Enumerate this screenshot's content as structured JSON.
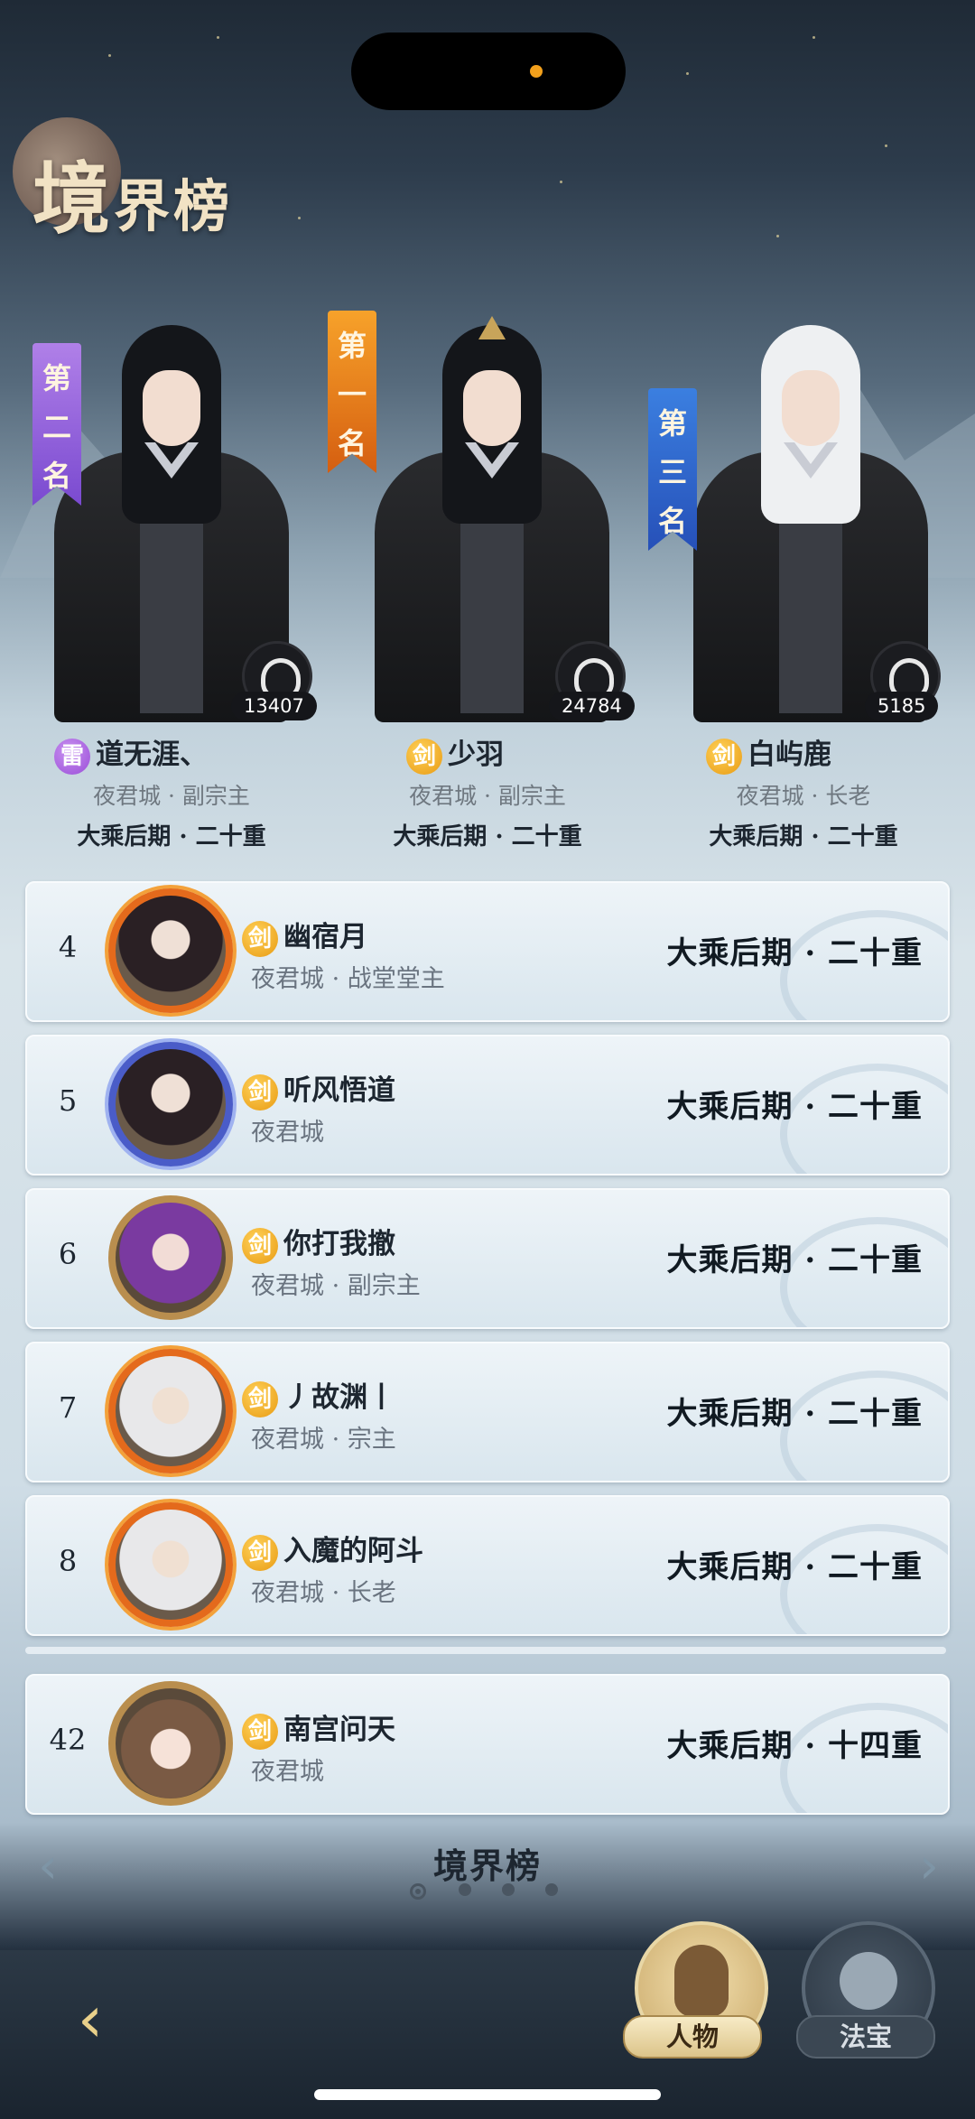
{
  "page": {
    "title_big": "境",
    "title_rest": "界榜"
  },
  "podium": [
    {
      "banner": "第二名",
      "element": "雷",
      "element_type": "thunder",
      "name": "道无涯、",
      "sect": "夜君城 · 副宗主",
      "realm": "大乘后期 · 二十重",
      "power": "13407"
    },
    {
      "banner": "第一名",
      "element": "剑",
      "element_type": "sword",
      "name": "少羽",
      "sect": "夜君城 · 副宗主",
      "realm": "大乘后期 · 二十重",
      "power": "24784"
    },
    {
      "banner": "第三名",
      "element": "剑",
      "element_type": "sword",
      "name": "白屿鹿",
      "sect": "夜君城 · 长老",
      "realm": "大乘后期 · 二十重",
      "power": "5185"
    }
  ],
  "rows": [
    {
      "rank": "4",
      "element": "剑",
      "name": "幽宿月",
      "sect": "夜君城 · 战堂堂主",
      "realm": "大乘后期 · 二十重"
    },
    {
      "rank": "5",
      "element": "剑",
      "name": "听风悟道",
      "sect": "夜君城",
      "realm": "大乘后期 · 二十重"
    },
    {
      "rank": "6",
      "element": "剑",
      "name": "你打我撤",
      "sect": "夜君城 · 副宗主",
      "realm": "大乘后期 · 二十重"
    },
    {
      "rank": "7",
      "element": "剑",
      "name": "丿故渊丨",
      "sect": "夜君城 · 宗主",
      "realm": "大乘后期 · 二十重"
    },
    {
      "rank": "8",
      "element": "剑",
      "name": "入魔的阿斗",
      "sect": "夜君城 · 长老",
      "realm": "大乘后期 · 二十重"
    }
  ],
  "self_row": {
    "rank": "42",
    "element": "剑",
    "name": "南宫问天",
    "sect": "夜君城",
    "realm": "大乘后期 · 十四重"
  },
  "footer": {
    "title": "境界榜",
    "page_index": 1,
    "page_count": 4,
    "prev_icon": "‹",
    "next_icon": "›"
  },
  "bottom_nav": {
    "back_icon": "back-icon",
    "tabs": [
      {
        "label": "人物",
        "active": true
      },
      {
        "label": "法宝",
        "active": false
      }
    ]
  },
  "colors": {
    "sword": "#e89a12",
    "thunder": "#9a4ed8",
    "first": "#e87a1c",
    "second": "#8a5ad8",
    "third": "#2f66cc"
  }
}
